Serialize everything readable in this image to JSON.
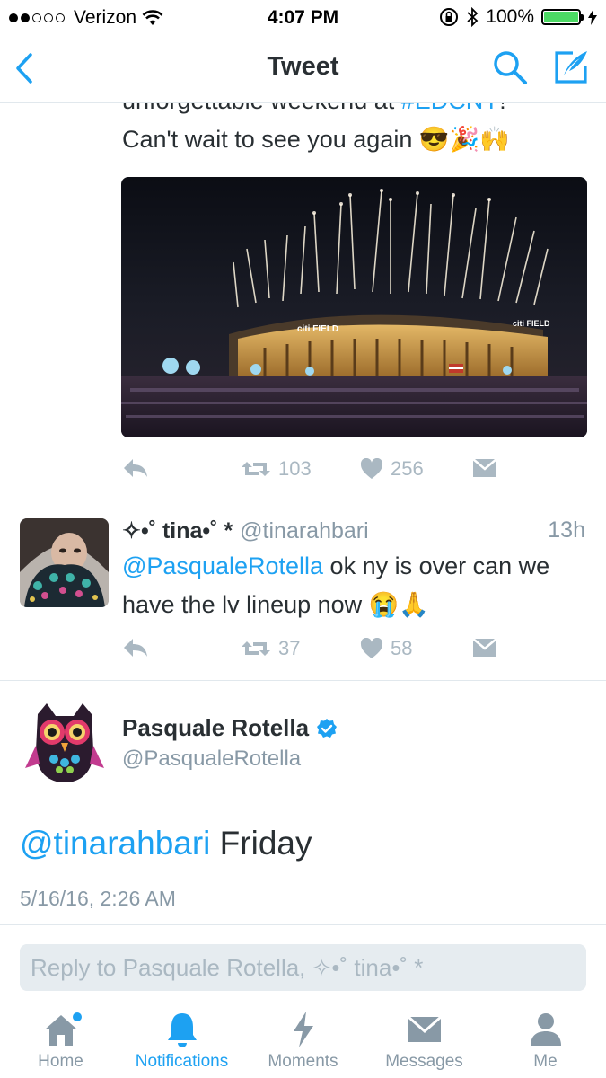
{
  "status_bar": {
    "carrier": "Verizon",
    "time": "4:07 PM",
    "battery": "100%"
  },
  "header": {
    "title": "Tweet"
  },
  "tweet_above": {
    "text_line1_start": "unforgettable weekend at ",
    "hashtag": "#EDCNY",
    "text_line1_end": "!",
    "text_line2": "Can't wait to see you again 😎🎉🙌",
    "photo_signs": [
      "citi FIELD",
      "citi FIELD"
    ],
    "retweets": "103",
    "likes": "256"
  },
  "reply_tweet": {
    "name": "✧•˚ tina•˚ *",
    "handle": "@tinarahbari",
    "time": "13h",
    "mention": "@PasqualeRotella",
    "text": " ok ny is over can we have the lv lineup now 😭🙏",
    "retweets": "37",
    "likes": "58"
  },
  "main_tweet": {
    "name": "Pasquale Rotella",
    "handle": "@PasqualeRotella",
    "mention": "@tinarahbari",
    "text": " Friday",
    "date": "5/16/16, 2:26 AM"
  },
  "reply_box": {
    "placeholder": "Reply to Pasquale Rotella, ✧•˚ tina•˚ *"
  },
  "tabs": [
    {
      "label": "Home"
    },
    {
      "label": "Notifications"
    },
    {
      "label": "Moments"
    },
    {
      "label": "Messages"
    },
    {
      "label": "Me"
    }
  ],
  "colors": {
    "accent": "#1da1f2",
    "muted": "#8899a6",
    "action_grey": "#aab8c2",
    "battery": "#4cd964"
  }
}
